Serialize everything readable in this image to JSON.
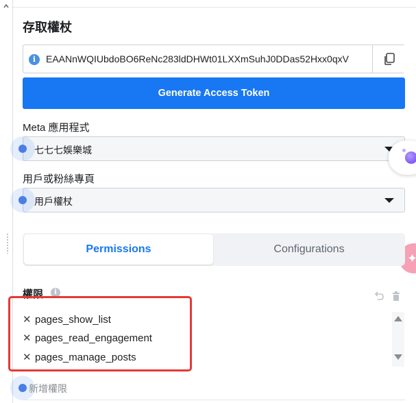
{
  "section": {
    "title": "存取權杖"
  },
  "token": {
    "value": "EAANnWQIUbdoBO6ReNc283ldDHWt01LXXmSuhJ0DDas52Hxx0qxV"
  },
  "generate_button": {
    "label": "Generate Access Token"
  },
  "meta_app": {
    "label": "Meta 應用程式",
    "selected": "七七七娛樂城"
  },
  "user_or_page": {
    "label": "用戶或粉絲專頁",
    "selected": "用戶權杖"
  },
  "tabs": [
    {
      "label": "Permissions",
      "active": true
    },
    {
      "label": "Configurations",
      "active": false
    }
  ],
  "permissions": {
    "label": "權限",
    "items": [
      "pages_show_list",
      "pages_read_engagement",
      "pages_manage_posts"
    ],
    "add_placeholder": "新增權限"
  },
  "icons": {
    "info": "info-icon",
    "copy": "copy-icon",
    "undo": "undo-icon",
    "trash": "trash-icon",
    "remove": "close-icon",
    "assistant": "assistant-orb-icon"
  },
  "colors": {
    "primary": "#1877f2",
    "highlight": "#e53935",
    "pink_widget": "#f7a1b6"
  }
}
